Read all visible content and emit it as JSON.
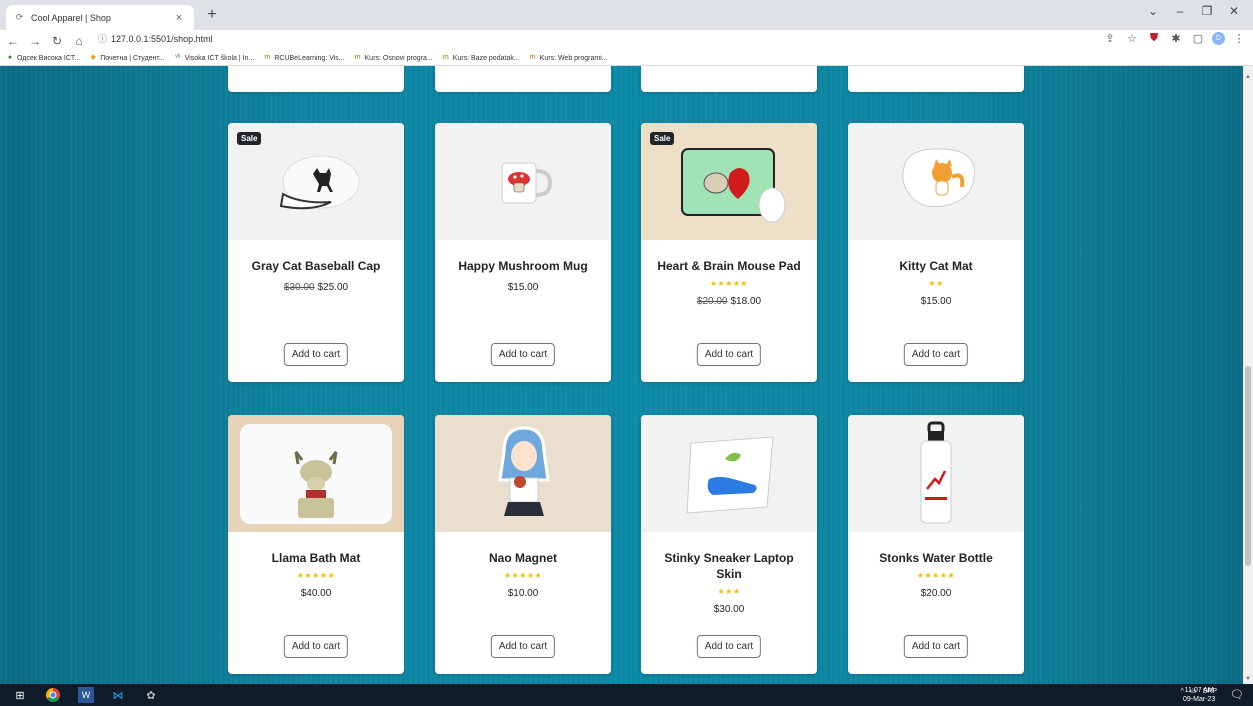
{
  "browser": {
    "tab_title": "Cool Apparel | Shop",
    "tab_close": "×",
    "new_tab": "+",
    "url": "127.0.0.1:5501/shop.html",
    "bookmarks": [
      {
        "label": "Одсек Висока ICT...",
        "icon": "globe-icon"
      },
      {
        "label": "Почетна | Студент...",
        "icon": "student-icon"
      },
      {
        "label": "Visoka ICT škola | In...",
        "icon": "vb-icon"
      },
      {
        "label": "RCUBeLearning: Vis...",
        "icon": "moodle-icon"
      },
      {
        "label": "Kurs: Osnovi progra...",
        "icon": "moodle-icon"
      },
      {
        "label": "Kurs: Baze podatak...",
        "icon": "moodle-icon"
      },
      {
        "label": "Kurs: Web programi...",
        "icon": "moodle-icon"
      }
    ],
    "profile_initial": "D"
  },
  "products_row1": [
    {
      "name": "Gray Cat Baseball Cap",
      "sale": "Sale",
      "stars": "",
      "old_price": "$30.00",
      "price": "$25.00",
      "button": "Add to cart",
      "img_bg": "#f2f2f2"
    },
    {
      "name": "Happy Mushroom Mug",
      "sale": "",
      "stars": "",
      "old_price": "",
      "price": "$15.00",
      "button": "Add to cart",
      "img_bg": "#f2f2f2"
    },
    {
      "name": "Heart & Brain Mouse Pad",
      "sale": "Sale",
      "stars": "★★★★★",
      "old_price": "$20.00",
      "price": "$18.00",
      "button": "Add to cart",
      "img_bg": "#eedfc8"
    },
    {
      "name": "Kitty Cat Mat",
      "sale": "",
      "stars": "★★",
      "old_price": "",
      "price": "$15.00",
      "button": "Add to cart",
      "img_bg": "#f2f2f2"
    }
  ],
  "products_row2": [
    {
      "name": "Llama Bath Mat",
      "sale": "",
      "stars": "★★★★★",
      "old_price": "",
      "price": "$40.00",
      "button": "Add to cart",
      "img_bg": "#e8d2b8"
    },
    {
      "name": "Nao Magnet",
      "sale": "",
      "stars": "★★★★★",
      "old_price": "",
      "price": "$10.00",
      "button": "Add to cart",
      "img_bg": "#eadfce"
    },
    {
      "name": "Stinky Sneaker Laptop Skin",
      "sale": "",
      "stars": "★★★",
      "old_price": "",
      "price": "$30.00",
      "button": "Add to cart",
      "img_bg": "#f2f2f2"
    },
    {
      "name": "Stonks Water Bottle",
      "sale": "",
      "stars": "★★★★★",
      "old_price": "",
      "price": "$20.00",
      "button": "Add to cart",
      "img_bg": "#f2f2f2"
    }
  ],
  "taskbar": {
    "lang": "SRP",
    "time": "11:07 AM",
    "date": "09-Mar-23",
    "notif_count": "2"
  }
}
